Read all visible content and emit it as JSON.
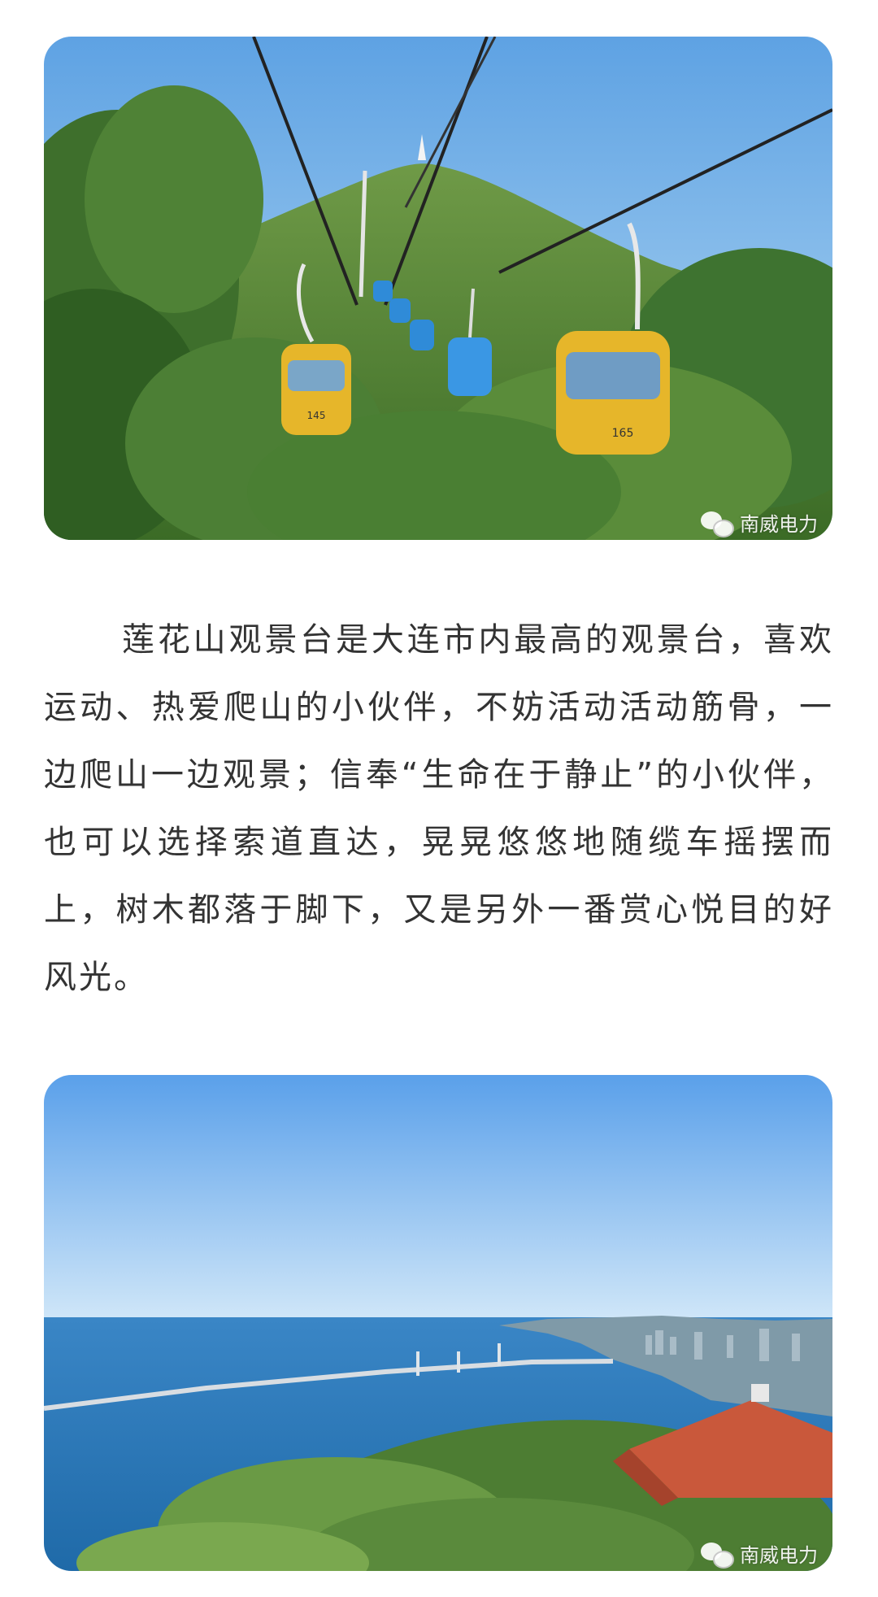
{
  "images": [
    {
      "alt": "索道缆车",
      "watermark": "南威电力",
      "icon": "wechat-icon",
      "cars": [
        {
          "number": "145",
          "color": "#e6b62a"
        },
        {
          "number": "165",
          "color": "#e6b62a"
        }
      ]
    },
    {
      "alt": "海景大桥",
      "watermark": "南威电力",
      "icon": "wechat-icon"
    }
  ],
  "article": {
    "paragraph": "莲花山观景台是大连市内最高的观景台，喜欢运动、热爱爬山的小伙伴，不妨活动活动筋骨，一边爬山一边观景；信奉“生命在于静止”的小伙伴，也可以选择索道直达，晃晃悠悠地随缆车摇摆而上，树木都落于脚下，又是另外一番赏心悦目的好风光。"
  },
  "colors": {
    "text": "#333333",
    "sky": "#7fb9ea",
    "sea": "#2f7fc0",
    "forest": "#3f7a2e"
  }
}
